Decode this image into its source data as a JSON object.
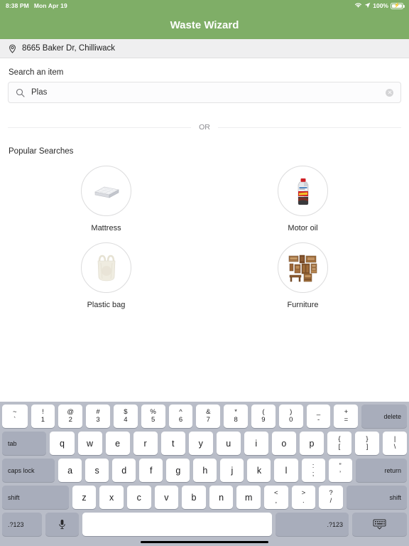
{
  "status_bar": {
    "time": "8:38 PM",
    "date": "Mon Apr 19",
    "battery_percent": "100%",
    "wifi_icon": "wifi-icon",
    "location_icon": "location-arrow-icon",
    "battery_icon": "battery-charging-icon"
  },
  "header": {
    "title": "Waste Wizard",
    "background_color": "#7fae67",
    "text_color": "#ffffff"
  },
  "address_bar": {
    "pin_icon": "map-pin-icon",
    "address": "8665 Baker Dr, Chilliwack",
    "background_color": "#efeff0"
  },
  "search": {
    "label": "Search an item",
    "value": "Plas",
    "placeholder": "Search an item",
    "search_icon": "search-icon",
    "clear_icon": "clear-circle-icon"
  },
  "divider": {
    "label": "OR"
  },
  "popular": {
    "title": "Popular Searches",
    "items": [
      {
        "label": "Mattress",
        "icon": "mattress-icon"
      },
      {
        "label": "Motor oil",
        "icon": "motor-oil-bottle-icon"
      },
      {
        "label": "Plastic bag",
        "icon": "plastic-bag-icon"
      },
      {
        "label": "Furniture",
        "icon": "furniture-collage-icon"
      }
    ]
  },
  "keyboard": {
    "background_color": "#b9bdc8",
    "row1": [
      {
        "top": "~",
        "bot": "`"
      },
      {
        "top": "!",
        "bot": "1"
      },
      {
        "top": "@",
        "bot": "2"
      },
      {
        "top": "#",
        "bot": "3"
      },
      {
        "top": "$",
        "bot": "4"
      },
      {
        "top": "%",
        "bot": "5"
      },
      {
        "top": "^",
        "bot": "6"
      },
      {
        "top": "&",
        "bot": "7"
      },
      {
        "top": "*",
        "bot": "8"
      },
      {
        "top": "(",
        "bot": "9"
      },
      {
        "top": ")",
        "bot": "0"
      },
      {
        "top": "_",
        "bot": "-"
      },
      {
        "top": "+",
        "bot": "="
      }
    ],
    "delete_label": "delete",
    "tab_label": "tab",
    "row2": [
      "q",
      "w",
      "e",
      "r",
      "t",
      "y",
      "u",
      "i",
      "o",
      "p"
    ],
    "row2_dual": [
      {
        "top": "{",
        "bot": "["
      },
      {
        "top": "}",
        "bot": "]"
      },
      {
        "top": "|",
        "bot": "\\"
      }
    ],
    "caps_label": "caps lock",
    "row3": [
      "a",
      "s",
      "d",
      "f",
      "g",
      "h",
      "j",
      "k",
      "l"
    ],
    "row3_dual": [
      {
        "top": ":",
        "bot": ";"
      },
      {
        "top": "”",
        "bot": "’"
      }
    ],
    "return_label": "return",
    "shift_left_label": "shift",
    "row4": [
      "z",
      "x",
      "c",
      "v",
      "b",
      "n",
      "m"
    ],
    "row4_dual": [
      {
        "top": "<",
        "bot": ","
      },
      {
        "top": ">",
        "bot": "."
      },
      {
        "top": "?",
        "bot": "/"
      }
    ],
    "shift_right_label": "shift",
    "numbers_left_label": ".?123",
    "numbers_right_label": ".?123",
    "mic_icon": "microphone-icon",
    "space_label": "",
    "hide_keyboard_icon": "hide-keyboard-icon"
  }
}
